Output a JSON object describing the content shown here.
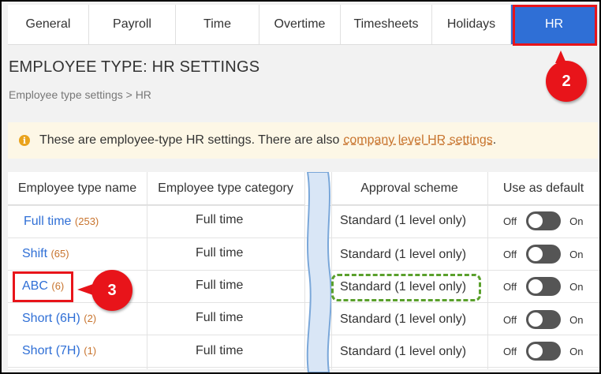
{
  "tabs": [
    {
      "label": "General",
      "active": false
    },
    {
      "label": "Payroll",
      "active": false
    },
    {
      "label": "Time",
      "active": false
    },
    {
      "label": "Overtime",
      "active": false
    },
    {
      "label": "Timesheets",
      "active": false
    },
    {
      "label": "Holidays",
      "active": false
    },
    {
      "label": "HR",
      "active": true
    }
  ],
  "annotations": {
    "step2": "2",
    "step3": "3"
  },
  "page": {
    "title": "EMPLOYEE TYPE: HR SETTINGS",
    "breadcrumb": "Employee type settings > HR"
  },
  "info": {
    "icon": "info-icon",
    "text": "These are employee-type HR settings. There are also",
    "link": "company level HR settings",
    "suffix": "."
  },
  "table": {
    "headers": {
      "name": "Employee type name",
      "category": "Employee type category",
      "scheme": "Approval scheme",
      "default": "Use as default"
    },
    "toggle_off": "Off",
    "toggle_on": "On",
    "rows": [
      {
        "name": "Full time",
        "count": "(253)",
        "category": "Full time",
        "scheme": "Standard (1 level only)"
      },
      {
        "name": "Shift",
        "count": "(65)",
        "category": "Full time",
        "scheme": "Standard (1 level only)"
      },
      {
        "name": "ABC",
        "count": "(6)",
        "category": "Full time",
        "scheme": "Standard (1 level only)"
      },
      {
        "name": "Short (6H)",
        "count": "(2)",
        "category": "Full time",
        "scheme": "Standard (1 level only)"
      },
      {
        "name": "Short (7H)",
        "count": "(1)",
        "category": "Full time",
        "scheme": "Standard (1 level only)"
      }
    ]
  },
  "colors": {
    "accent": "#2f6fd6",
    "highlight_red": "#e8141a",
    "highlight_green": "#5aa02c",
    "link_orange": "#c8742e"
  }
}
